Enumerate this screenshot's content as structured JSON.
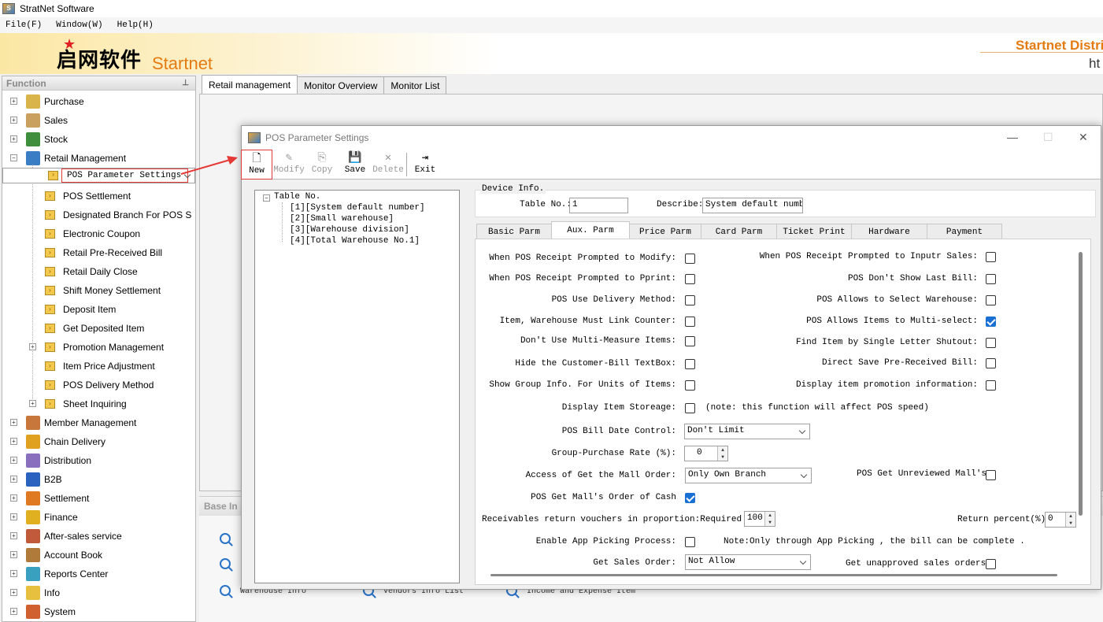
{
  "app": {
    "title": "StratNet Software",
    "icon_text": "S"
  },
  "menu": [
    "File(F)",
    "Window(W)",
    "Help(H)"
  ],
  "banner": {
    "logo_cn": "启网软件",
    "logo_en": "Startnet",
    "brand_right": "Startnet Distribu",
    "brand_url": "ht"
  },
  "sidebar": {
    "header": "Function",
    "items": [
      {
        "label": "Purchase",
        "icon": "purchase-icon",
        "color": "#d8b44a"
      },
      {
        "label": "Sales",
        "icon": "sales-icon",
        "color": "#caa060"
      },
      {
        "label": "Stock",
        "icon": "stock-icon",
        "color": "#3f8f3f"
      },
      {
        "label": "Retail Management",
        "icon": "retail-cart-icon",
        "color": "#3b7dc4"
      }
    ],
    "retail_children": [
      "POS Parameter Settings",
      "POS Settlement",
      "Designated Branch For POS S",
      "Electronic Coupon",
      "Retail Pre-Received Bill",
      "Retail Daily Close",
      "Shift Money Settlement",
      "Deposit Item",
      "Get Deposited Item",
      "Promotion Management",
      "Item Price Adjustment",
      "POS Delivery Method",
      "Sheet Inquiring"
    ],
    "more_items": [
      {
        "label": "Member Management",
        "icon": "member-icon",
        "color": "#c7773b"
      },
      {
        "label": "Chain Delivery",
        "icon": "truck-icon",
        "color": "#e0a020"
      },
      {
        "label": "Distribution",
        "icon": "distribution-icon",
        "color": "#8a6fbf"
      },
      {
        "label": "B2B",
        "icon": "b2b-icon",
        "color": "#2a62c0"
      },
      {
        "label": "Settlement",
        "icon": "settlement-icon",
        "color": "#e07a22"
      },
      {
        "label": "Finance",
        "icon": "yen-icon",
        "color": "#e0b020"
      },
      {
        "label": "After-sales service",
        "icon": "after-sales-icon",
        "color": "#c05a3a"
      },
      {
        "label": "Account Book",
        "icon": "account-book-icon",
        "color": "#b07a3a"
      },
      {
        "label": "Reports Center",
        "icon": "reports-icon",
        "color": "#3aa0c0"
      },
      {
        "label": "Info",
        "icon": "info-folder-icon",
        "color": "#e8c040"
      },
      {
        "label": "System",
        "icon": "system-icon",
        "color": "#d06030"
      }
    ]
  },
  "main_tabs": [
    "Retail management",
    "Monitor Overview",
    "Monitor List"
  ],
  "base_info": {
    "title": "Base In",
    "links": [
      "Warehouse Info",
      "Vendors Info List",
      "Income and Expense Item"
    ]
  },
  "dialog": {
    "title": "POS Parameter Settings",
    "toolbar": [
      {
        "label": "New",
        "enabled": true,
        "icon": "new-doc-icon"
      },
      {
        "label": "Modify",
        "enabled": false,
        "icon": "modify-icon"
      },
      {
        "label": "Copy",
        "enabled": false,
        "icon": "copy-icon"
      },
      {
        "label": "Save",
        "enabled": true,
        "icon": "save-icon"
      },
      {
        "label": "Delete",
        "enabled": false,
        "icon": "delete-icon"
      },
      {
        "label": "Exit",
        "enabled": true,
        "icon": "exit-icon"
      }
    ],
    "tree": {
      "root": "Table No.",
      "items": [
        "[1][System default number]",
        "[2][Small warehouse]",
        "[3][Warehouse division]",
        "[4][Total Warehouse No.1]"
      ]
    },
    "device_info": {
      "legend": "Device Info.",
      "table_no_label": "Table No.:",
      "table_no": "1",
      "describe_label": "Describe:",
      "describe": "System default number"
    },
    "subtabs": [
      "Basic Parm",
      "Aux. Parm",
      "Price Parm",
      "Card Parm",
      "Ticket Print",
      "Hardware",
      "Payment"
    ],
    "aux": {
      "left": [
        {
          "label": "When POS Receipt Prompted to Modify:",
          "checked": false
        },
        {
          "label": "When POS Receipt Prompted to Pprint:",
          "checked": false
        },
        {
          "label": "POS Use Delivery Method:",
          "checked": false
        },
        {
          "label": "Item, Warehouse Must Link Counter:",
          "checked": false
        },
        {
          "label": "Don't Use Multi-Measure Items:",
          "checked": false
        },
        {
          "label": "Hide the Customer-Bill TextBox:",
          "checked": false
        },
        {
          "label": "Show Group Info. For Units of Items:",
          "checked": false
        }
      ],
      "right": [
        {
          "label": "When POS Receipt Prompted to Inputr Sales:",
          "checked": false
        },
        {
          "label": "POS Don't Show Last Bill:",
          "checked": false
        },
        {
          "label": "POS Allows to Select Warehouse:",
          "checked": false
        },
        {
          "label": "POS Allows Items to Multi-select:",
          "checked": true
        },
        {
          "label": "Find Item by Single Letter Shutout:",
          "checked": false
        },
        {
          "label": "Direct Save Pre-Received Bill:",
          "checked": false
        },
        {
          "label": "Display item promotion information:",
          "checked": false
        }
      ],
      "display_storage_label": "Display Item Storeage:",
      "display_storage_note": "(note: this function will affect POS speed)",
      "bill_date_label": "POS Bill Date Control:",
      "bill_date_value": "Don't Limit",
      "group_rate_label": "Group-Purchase Rate (%):",
      "group_rate_value": "0",
      "mall_order_label": "Access of Get the Mall Order:",
      "mall_order_value": "Only Own Branch",
      "unreviewed_label": "POS Get Unreviewed  Mall's",
      "cash_order_label": "POS Get Mall's Order of Cash",
      "cash_order_checked": true,
      "receivables_label": "Receivables return vouchers in proportion:Required Amt.",
      "required_amt": "100",
      "return_percent_label": "Return percent(%):",
      "return_percent": "0",
      "app_picking_label": "Enable App Picking Process:",
      "app_picking_note": "Note:Only through App Picking , the bill can be complete .",
      "sales_order_label": "Get Sales Order:",
      "sales_order_value": "Not Allow",
      "unapproved_label": "Get unapproved sales orders:"
    }
  },
  "colors": {
    "accent": "#1a6fd4",
    "highlight": "#e53935",
    "brand": "#e47a12"
  }
}
